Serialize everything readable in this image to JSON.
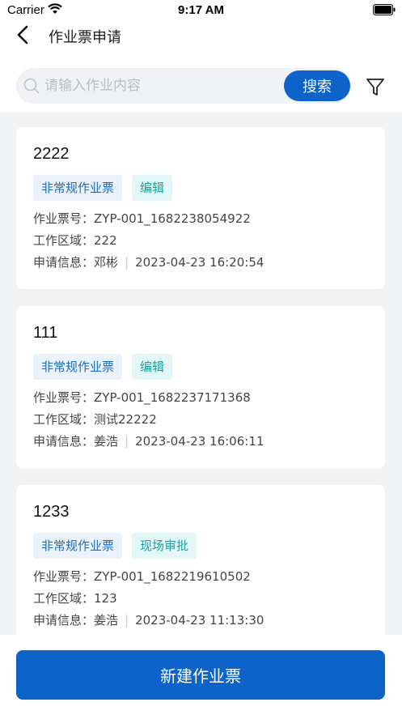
{
  "status_bar": {
    "carrier": "Carrier",
    "time": "9:17 AM"
  },
  "header": {
    "title": "作业票申请"
  },
  "search": {
    "placeholder": "请输入作业内容",
    "button_label": "搜索"
  },
  "cards": [
    {
      "title": "2222",
      "type_tag": "非常规作业票",
      "status_tag": "编辑",
      "ticket_label": "作业票号：",
      "ticket_no": "ZYP-001_1682238054922",
      "area_label": "工作区域：",
      "area": "222",
      "apply_label": "申请信息：",
      "applicant": "邓彬",
      "separator": "|",
      "time": "2023-04-23 16:20:54"
    },
    {
      "title": "111",
      "type_tag": "非常规作业票",
      "status_tag": "编辑",
      "ticket_label": "作业票号：",
      "ticket_no": "ZYP-001_1682237171368",
      "area_label": "工作区域：",
      "area": "测试22222",
      "apply_label": "申请信息：",
      "applicant": "姜浩",
      "separator": "|",
      "time": "2023-04-23 16:06:11"
    },
    {
      "title": "1233",
      "type_tag": "非常规作业票",
      "status_tag": "现场审批",
      "ticket_label": "作业票号：",
      "ticket_no": "ZYP-001_1682219610502",
      "area_label": "工作区域：",
      "area": "123",
      "apply_label": "申请信息：",
      "applicant": "姜浩",
      "separator": "|",
      "time": "2023-04-23 11:13:30"
    }
  ],
  "footer": {
    "new_button_label": "新建作业票"
  },
  "colors": {
    "primary": "#0e63c9",
    "tag_type_bg": "#eaf3fc",
    "tag_status_bg": "#e4f7f7",
    "background": "#f2f3f5"
  },
  "icons": {
    "back": "chevron-left-icon",
    "search": "search-icon",
    "filter": "filter-icon",
    "wifi": "wifi-icon",
    "battery": "battery-icon"
  }
}
